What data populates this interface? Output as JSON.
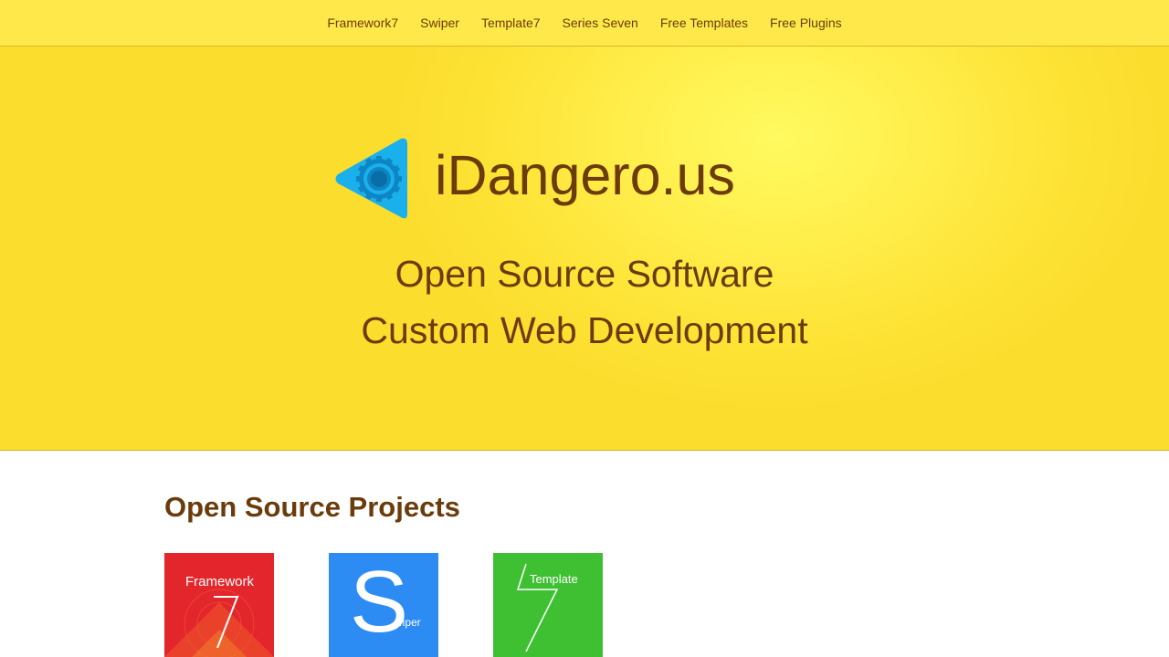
{
  "nav": {
    "items": [
      {
        "label": "Framework7"
      },
      {
        "label": "Swiper"
      },
      {
        "label": "Template7"
      },
      {
        "label": "Series Seven"
      },
      {
        "label": "Free Templates"
      },
      {
        "label": "Free Plugins"
      }
    ]
  },
  "hero": {
    "brand": "iDangero.us",
    "logo_icon": "gear-play-icon",
    "tagline_1": "Open Source Software",
    "tagline_2": "Custom Web Development"
  },
  "projects": {
    "title": "Open Source Projects",
    "items": [
      {
        "label": "Framework",
        "glyph": "7",
        "color": "#e3262b"
      },
      {
        "label": "wiper",
        "glyph": "S",
        "color": "#2c8cf4"
      },
      {
        "label": "Template",
        "glyph": "7",
        "color": "#3fc033"
      }
    ]
  },
  "colors": {
    "text_brown": "#6b3b0b",
    "hero_yellow": "#fde335",
    "logo_blue": "#1ab0ec"
  }
}
